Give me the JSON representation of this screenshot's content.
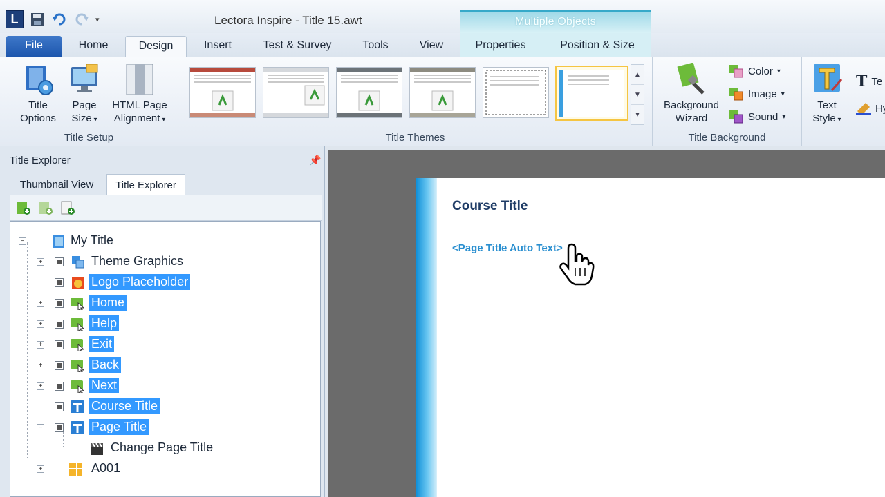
{
  "window": {
    "title": "Lectora Inspire - Title 15.awt",
    "contextual_tab_header": "Multiple Objects",
    "app_logo_letter": "L"
  },
  "tabs": [
    {
      "label": "File"
    },
    {
      "label": "Home"
    },
    {
      "label": "Design"
    },
    {
      "label": "Insert"
    },
    {
      "label": "Test & Survey"
    },
    {
      "label": "Tools"
    },
    {
      "label": "View"
    },
    {
      "label": "Properties"
    },
    {
      "label": "Position & Size"
    }
  ],
  "active_tab": "Design",
  "ribbon": {
    "title_setup": {
      "label": "Title Setup",
      "title_options_1": "Title",
      "title_options_2": "Options",
      "page_size_1": "Page",
      "page_size_2": "Size",
      "html_align_1": "HTML Page",
      "html_align_2": "Alignment"
    },
    "title_themes": {
      "label": "Title Themes",
      "thumb_count": 6,
      "selected_index": 5
    },
    "title_background": {
      "label": "Title Background",
      "bg_wizard_1": "Background",
      "bg_wizard_2": "Wizard",
      "color": "Color",
      "image": "Image",
      "sound": "Sound"
    },
    "text_style": {
      "label_1": "Text",
      "label_2": "Style",
      "cut_1": "Te",
      "cut_2": "Hy"
    }
  },
  "left_pane": {
    "title": "Title Explorer",
    "tabs": [
      {
        "label": "Thumbnail View"
      },
      {
        "label": "Title Explorer"
      }
    ],
    "active_tab": "Title Explorer",
    "tree": {
      "root": "My Title",
      "theme_graphics": "Theme Graphics",
      "logo_placeholder": "Logo Placeholder",
      "home": "Home",
      "help": "Help",
      "exit": "Exit",
      "back": "Back",
      "next": "Next",
      "course_title": "Course Title",
      "page_title": "Page Title",
      "change_page_title": "Change Page Title",
      "a001": "A001"
    }
  },
  "canvas": {
    "course_title": "Course Title",
    "page_title_auto_text": "<Page Title Auto Text>"
  },
  "colors": {
    "selection": "#3399ff",
    "file_tab": "#2a63b8",
    "canvas_bg": "#6b6b6b",
    "page_title_text": "#2a8fd0"
  }
}
